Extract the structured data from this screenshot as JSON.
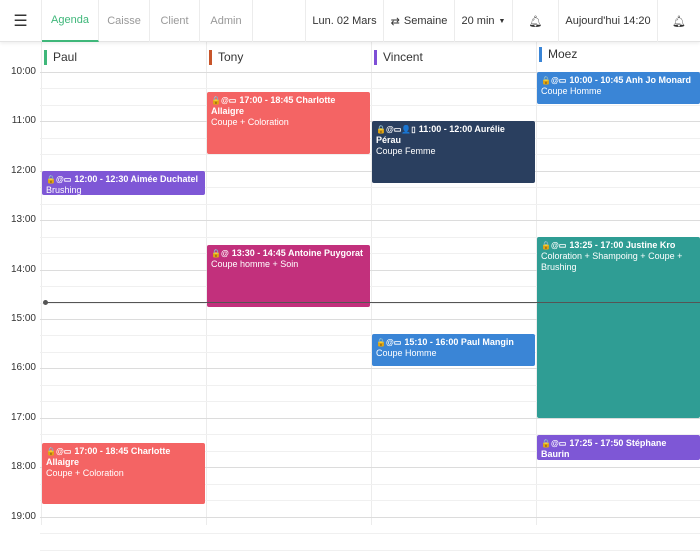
{
  "nav": {
    "tabs": [
      "Agenda",
      "Caisse",
      "Client",
      "Admin"
    ],
    "date": "Lun. 02 Mars",
    "view": "Semaine",
    "interval": "20 min",
    "today": "Aujourd'hui 14:20"
  },
  "staff": [
    {
      "name": "Paul",
      "color": "#3fb77a"
    },
    {
      "name": "Tony",
      "color": "#c8552a"
    },
    {
      "name": "Vincent",
      "color": "#7e4fd6"
    },
    {
      "name": "Moez",
      "color": "#3a85d6"
    }
  ],
  "hours": [
    "10:00",
    "11:00",
    "12:00",
    "13:00",
    "14:00",
    "15:00",
    "16:00",
    "17:00",
    "18:00",
    "19:00"
  ],
  "events": [
    {
      "icons": "🔒@▭",
      "title": "12:00 - 12:30 Aimée Duchatel",
      "service": "Brushing",
      "color": "#7e57d6"
    },
    {
      "icons": "🔒@▭",
      "title": "17:00 - 18:45 Charlotte Allaigre",
      "service": "Coupe + Coloration",
      "color": "#f46464"
    },
    {
      "icons": "🔒@▭",
      "title": "17:00 - 18:45 Charlotte Allaigre",
      "service": "Coupe + Coloration",
      "color": "#f46464"
    },
    {
      "icons": "🔒@",
      "title": "13:30 - 14:45 Antoine Puygorat",
      "service": "Coupe homme + Soin",
      "color": "#c2307c"
    },
    {
      "icons": "🔒@▭👤▯",
      "title": "11:00 - 12:00 Aurélie Pérau",
      "service": "Coupe Femme",
      "color": "#2a3f5f"
    },
    {
      "icons": "🔒@▭",
      "title": "15:10 - 16:00 Paul Mangin",
      "service": "Coupe Homme",
      "color": "#3a85d6"
    },
    {
      "icons": "🔒@▭",
      "title": "10:00 - 10:45 Anh Jo Monard",
      "service": "Coupe Homme",
      "color": "#3a85d6"
    },
    {
      "icons": "🔒@▭",
      "title": "13:25 - 17:00 Justine Kro",
      "service": "Coloration + Shampoing + Coupe + Brushing",
      "color": "#2f9d94"
    },
    {
      "icons": "🔒@▭",
      "title": "17:25 - 17:50 Stéphane Baurin",
      "service": "Brushing",
      "color": "#7e57d6"
    }
  ]
}
